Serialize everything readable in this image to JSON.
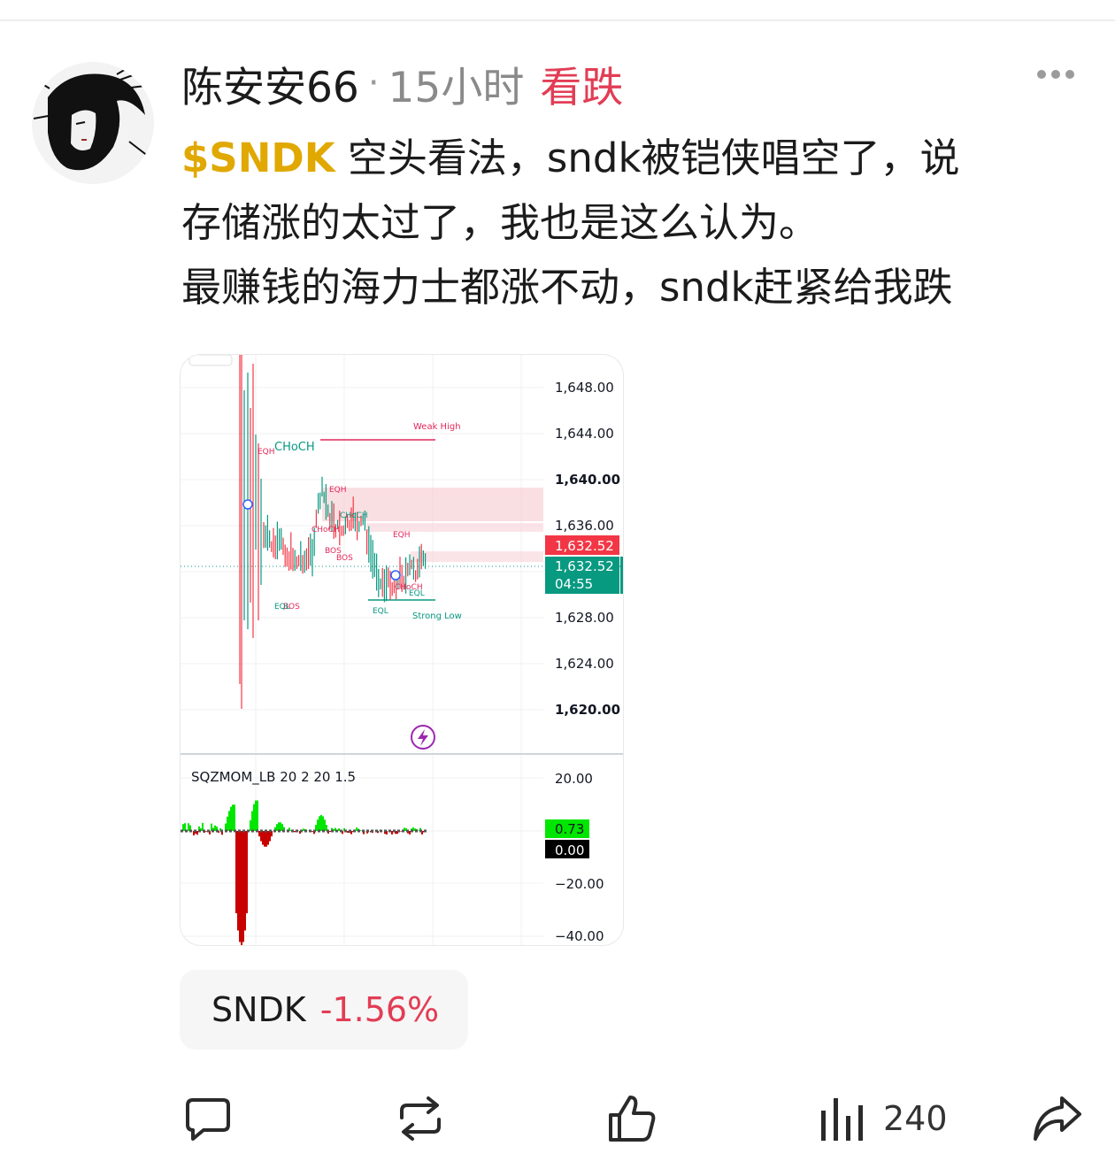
{
  "post": {
    "username": "陈安安66",
    "separator": "·",
    "time": "15小时",
    "sentiment": "看跌",
    "ticker": "$SNDK",
    "lines": [
      " 空头看法，sndk被铠侠唱空了，说",
      "存储涨的太过了，我也是这么认为。",
      "最赚钱的海力士都涨不动，sndk赶紧给我跌"
    ]
  },
  "chart": {
    "price_axis": [
      "1,648.00",
      "1,644.00",
      "1,640.00",
      "1,636.00",
      "1,628.00",
      "1,624.00",
      "1,620.00"
    ],
    "current_price_tag": "1,632.52",
    "last_price_tag": "1,632.52",
    "countdown": "04:55",
    "annotations": {
      "weak_high": "Weak High",
      "strong_low": "Strong Low",
      "choch_main": "CHoCH",
      "eqh1": "EQH",
      "eqh2": "EQH",
      "eqh3": "EQH",
      "choch2": "CHoCH",
      "choch3": "CHoCH",
      "choch4": "CHoCH",
      "bos1": "BOS",
      "bos2": "BOS",
      "bos3": "BOS",
      "eql1": "EQL",
      "eql2": "EQL",
      "eql3": "EQL"
    },
    "indicator": {
      "name": "SQZMOM_LB 20 2 20 1.5",
      "axis": [
        "20.00",
        "−20.00",
        "−40.00"
      ],
      "value_tag": "0.73",
      "zero_tag": "0.00"
    },
    "colors": {
      "up": "#089981",
      "down": "#f23645",
      "bull_hist": "#00e600",
      "bear_hist": "#c80000"
    }
  },
  "stock_chip": {
    "symbol": "SNDK",
    "change": "-1.56%"
  },
  "actions": {
    "views": "240"
  },
  "icons": [
    "avatar",
    "more-icon",
    "comment-icon",
    "repost-icon",
    "like-icon",
    "views-icon",
    "share-icon",
    "lightning-icon"
  ]
}
